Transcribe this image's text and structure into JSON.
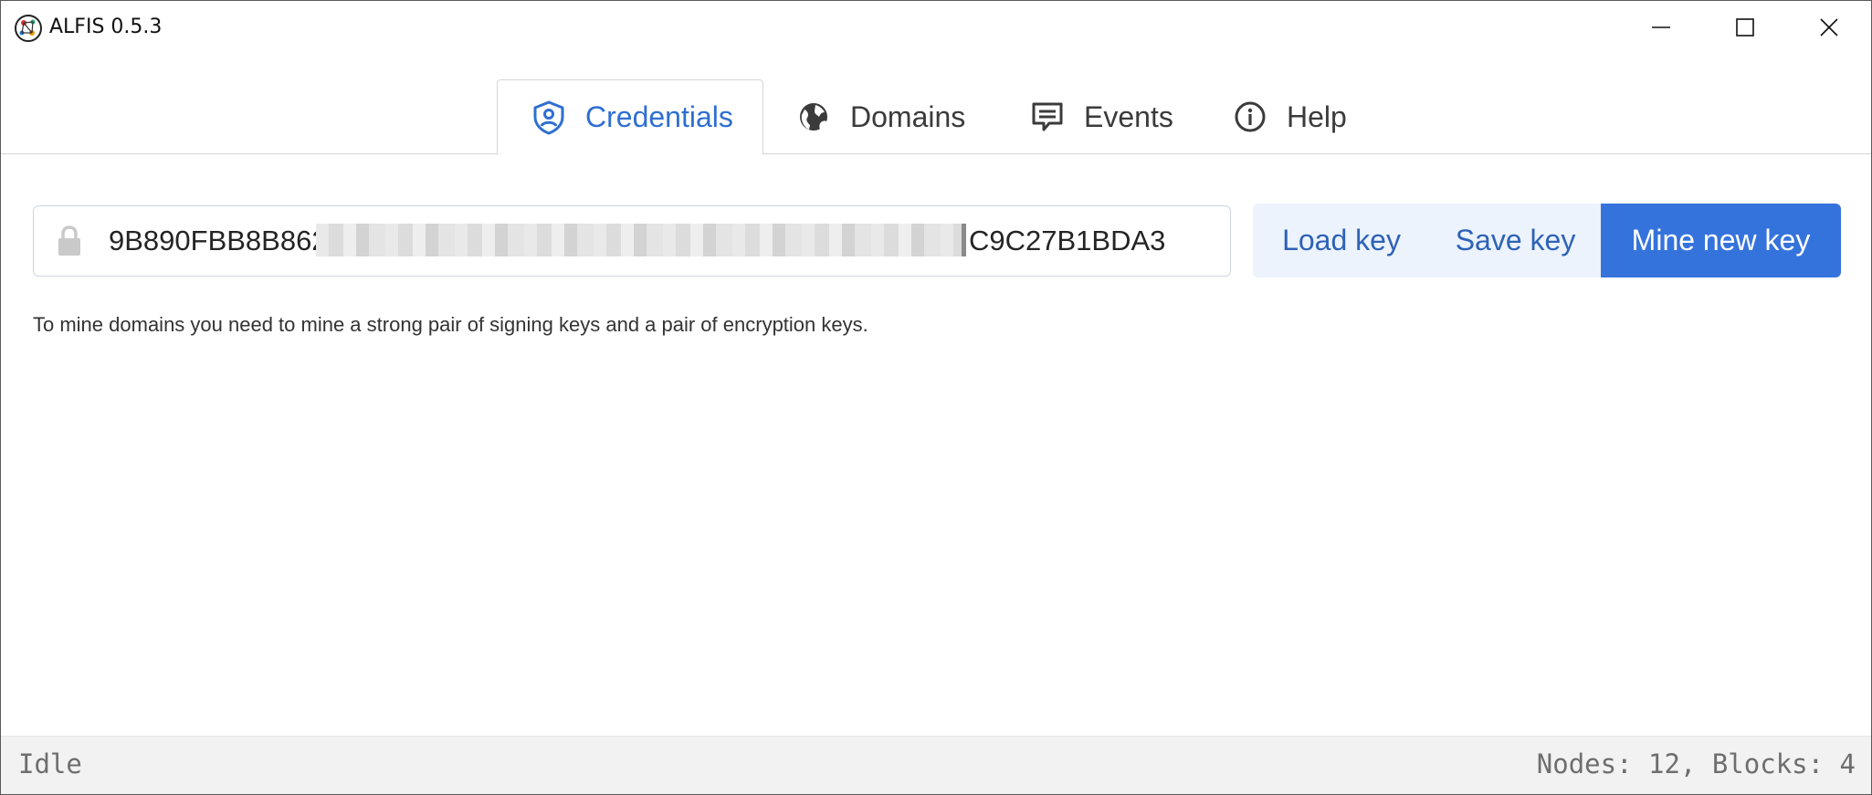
{
  "window": {
    "title": "ALFIS 0.5.3",
    "controls": [
      "minimize-icon",
      "maximize-icon",
      "close-icon"
    ]
  },
  "tabs": [
    {
      "label": "Credentials",
      "icon": "shield-user-icon",
      "active": true
    },
    {
      "label": "Domains",
      "icon": "globe-icon",
      "active": false
    },
    {
      "label": "Events",
      "icon": "message-icon",
      "active": false
    },
    {
      "label": "Help",
      "icon": "info-icon",
      "active": false
    }
  ],
  "credentials": {
    "key_prefix": "9B890FBB8B862",
    "key_suffix": "C9C27B1BDA3",
    "key_redacted": true,
    "load_label": "Load key",
    "save_label": "Save key",
    "mine_label": "Mine new key",
    "hint": "To mine domains you need to mine a strong pair of signing keys and a pair of encryption keys."
  },
  "status": {
    "left": "Idle",
    "right": "Nodes: 12, Blocks: 4"
  },
  "colors": {
    "accent": "#3573dc",
    "accent_text": "#2f6fd1",
    "button_group_bg": "#ecf3fd",
    "statusbar_bg": "#f2f2f2"
  }
}
